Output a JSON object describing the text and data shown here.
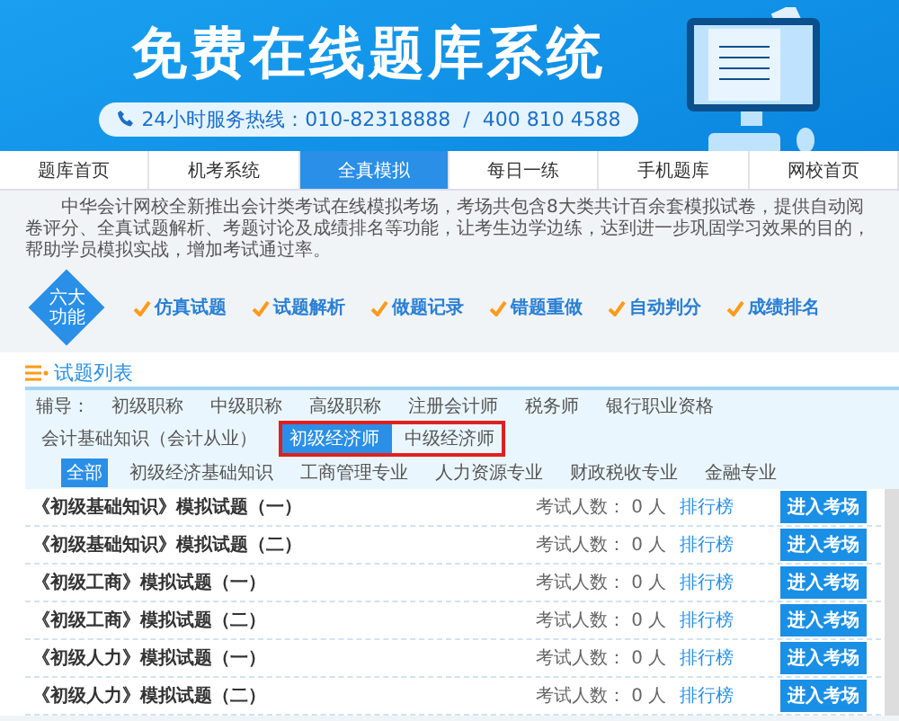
{
  "banner": {
    "title": "免费在线题库系统",
    "hotline": "24小时服务热线：010-82318888  /  400 810 4588"
  },
  "nav": [
    {
      "label": "题库首页",
      "selected": false
    },
    {
      "label": "机考系统",
      "selected": false
    },
    {
      "label": "全真模拟",
      "selected": true
    },
    {
      "label": "每日一练",
      "selected": false
    },
    {
      "label": "手机题库",
      "selected": false
    },
    {
      "label": "网校首页",
      "selected": false
    }
  ],
  "intro": "中华会计网校全新推出会计类考试在线模拟考场，考场共包含8大类共计百余套模拟试卷，提供自动阅卷评分、全真试题解析、考题讨论及成绩排名等功能，让考生边学边练，达到进一步巩固学习效果的目的，帮助学员模拟实战，增加考试通过率。",
  "features": {
    "badge": "六大功能",
    "items": [
      "仿真试题",
      "试题解析",
      "做题记录",
      "错题重做",
      "自动判分",
      "成绩排名"
    ]
  },
  "list_title": "试题列表",
  "subjects": {
    "label": "辅导：",
    "items": [
      {
        "label": "初级职称",
        "selected": false,
        "highlighted": false
      },
      {
        "label": "中级职称",
        "selected": false,
        "highlighted": false
      },
      {
        "label": "高级职称",
        "selected": false,
        "highlighted": false
      },
      {
        "label": "注册会计师",
        "selected": false,
        "highlighted": false
      },
      {
        "label": "税务师",
        "selected": false,
        "highlighted": false
      },
      {
        "label": "银行职业资格",
        "selected": false,
        "highlighted": false
      },
      {
        "label": "会计基础知识（会计从业）",
        "selected": false,
        "highlighted": false
      },
      {
        "label": "初级经济师",
        "selected": true,
        "highlighted": true
      },
      {
        "label": "中级经济师",
        "selected": false,
        "highlighted": true
      }
    ]
  },
  "categories": [
    {
      "label": "全部",
      "selected": true
    },
    {
      "label": "初级经济基础知识",
      "selected": false
    },
    {
      "label": "工商管理专业",
      "selected": false
    },
    {
      "label": "人力资源专业",
      "selected": false
    },
    {
      "label": "财政税收专业",
      "selected": false
    },
    {
      "label": "金融专业",
      "selected": false
    }
  ],
  "exams": [
    {
      "title": "《初级基础知识》模拟试题（一）",
      "count": "考试人数： 0 人",
      "rank": "排行榜",
      "action": "进入考场"
    },
    {
      "title": "《初级基础知识》模拟试题（二）",
      "count": "考试人数： 0 人",
      "rank": "排行榜",
      "action": "进入考场"
    },
    {
      "title": "《初级工商》模拟试题（一）",
      "count": "考试人数： 0 人",
      "rank": "排行榜",
      "action": "进入考场"
    },
    {
      "title": "《初级工商》模拟试题（二）",
      "count": "考试人数： 0 人",
      "rank": "排行榜",
      "action": "进入考场"
    },
    {
      "title": "《初级人力》模拟试题（一）",
      "count": "考试人数： 0 人",
      "rank": "排行榜",
      "action": "进入考场"
    },
    {
      "title": "《初级人力》模拟试题（二）",
      "count": "考试人数： 0 人",
      "rank": "排行榜",
      "action": "进入考场"
    }
  ]
}
